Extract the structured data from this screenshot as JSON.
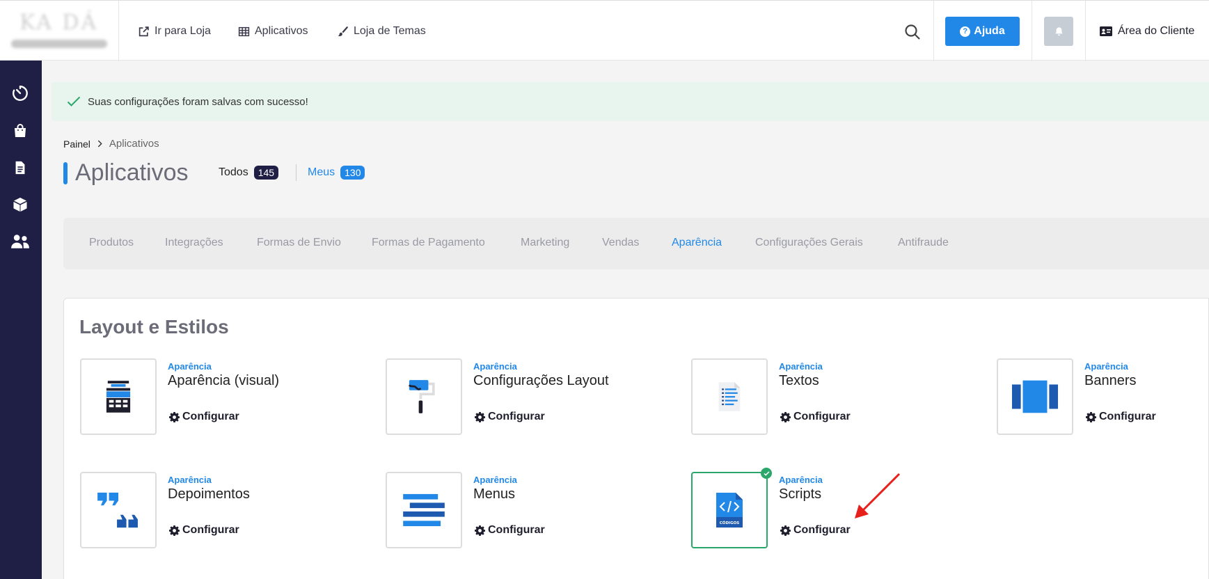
{
  "header": {
    "logo_text": "KA DÁ",
    "nav": [
      {
        "label": "Ir para Loja",
        "icon": "external-link-icon"
      },
      {
        "label": "Aplicativos",
        "icon": "grid-icon"
      },
      {
        "label": "Loja de Temas",
        "icon": "paintbrush-icon"
      }
    ],
    "help_label": "Ajuda",
    "client_label": "Área do Cliente"
  },
  "sidebar": {
    "items": [
      {
        "icon": "dashboard-icon"
      },
      {
        "icon": "shopping-bag-icon"
      },
      {
        "icon": "document-icon"
      },
      {
        "icon": "box-icon"
      },
      {
        "icon": "users-icon"
      }
    ]
  },
  "alert": {
    "message": "Suas configurações foram salvas com sucesso!"
  },
  "breadcrumb": {
    "home": "Painel",
    "current": "Aplicativos"
  },
  "page": {
    "title": "Aplicativos",
    "filters": [
      {
        "label": "Todos",
        "count": "145"
      },
      {
        "label": "Meus",
        "count": "130"
      }
    ]
  },
  "tabs": [
    {
      "label": "Produtos"
    },
    {
      "label": "Integrações"
    },
    {
      "label": "Formas de Envio"
    },
    {
      "label": "Formas de Pagamento"
    },
    {
      "label": "Marketing"
    },
    {
      "label": "Vendas"
    },
    {
      "label": "Aparência",
      "active": true
    },
    {
      "label": "Configurações Gerais"
    },
    {
      "label": "Antifraude"
    }
  ],
  "section": {
    "title": "Layout e Estilos",
    "apps": [
      {
        "category": "Aparência",
        "name": "Aparência (visual)",
        "action": "Configurar",
        "icon": "storefront-icon"
      },
      {
        "category": "Aparência",
        "name": "Configurações Layout",
        "action": "Configurar",
        "icon": "paint-roller-icon"
      },
      {
        "category": "Aparência",
        "name": "Textos",
        "action": "Configurar",
        "icon": "text-document-icon"
      },
      {
        "category": "Aparência",
        "name": "Banners",
        "action": "Configurar",
        "icon": "carousel-icon"
      },
      {
        "category": "Aparência",
        "name": "Depoimentos",
        "action": "Configurar",
        "icon": "quotes-icon"
      },
      {
        "category": "Aparência",
        "name": "Menus",
        "action": "Configurar",
        "icon": "menu-lines-icon"
      },
      {
        "category": "Aparência",
        "name": "Scripts",
        "action": "Configurar",
        "icon": "code-file-icon",
        "icon_caption": "CÓDIGOS",
        "installed": true
      }
    ]
  },
  "colors": {
    "primary": "#2288e8",
    "sidebar": "#1f1f46",
    "success": "#2aa76a",
    "badge_dark": "#1f1f46",
    "annotation_arrow": "#e8201c"
  }
}
